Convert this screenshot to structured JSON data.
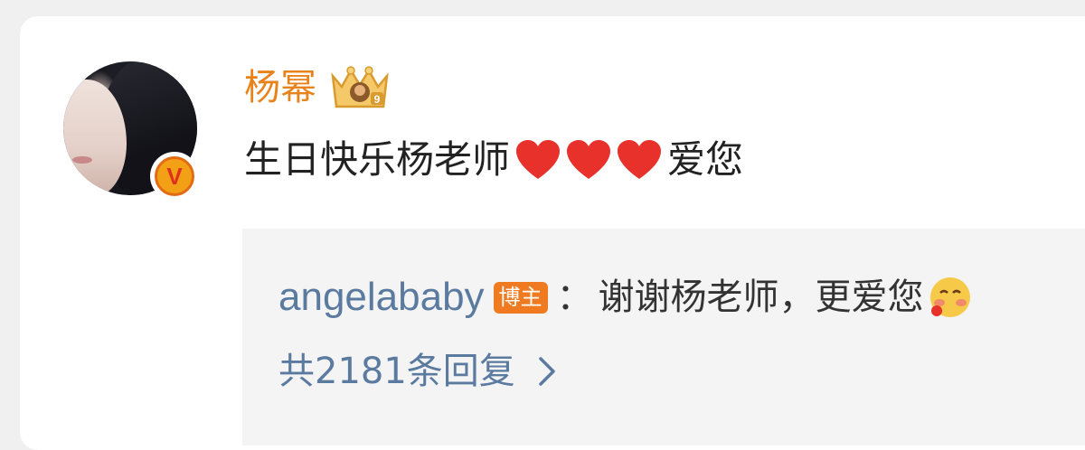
{
  "comment": {
    "username": "杨幂",
    "text_before": "生日快乐杨老师",
    "text_after": "爱您",
    "heart_count": 3
  },
  "icons": {
    "verified": "verified-v-badge",
    "crown": "crown-icon",
    "heart": "heart-icon",
    "emoji": "blush-emoji-icon",
    "chevron": "chevron-right-icon"
  },
  "verified_badge": {
    "label": "V"
  },
  "reply": {
    "username": "angelababy",
    "author_badge": "博主",
    "separator": "：",
    "text": "谢谢杨老师，更爱您"
  },
  "replies": {
    "count_label": "共2181条回复"
  },
  "colors": {
    "username": "#e8831b",
    "reply_link": "#5b7aa0",
    "heart": "#e8312b",
    "author_badge": "#f07a1f",
    "reply_bg": "#f4f4f4"
  }
}
